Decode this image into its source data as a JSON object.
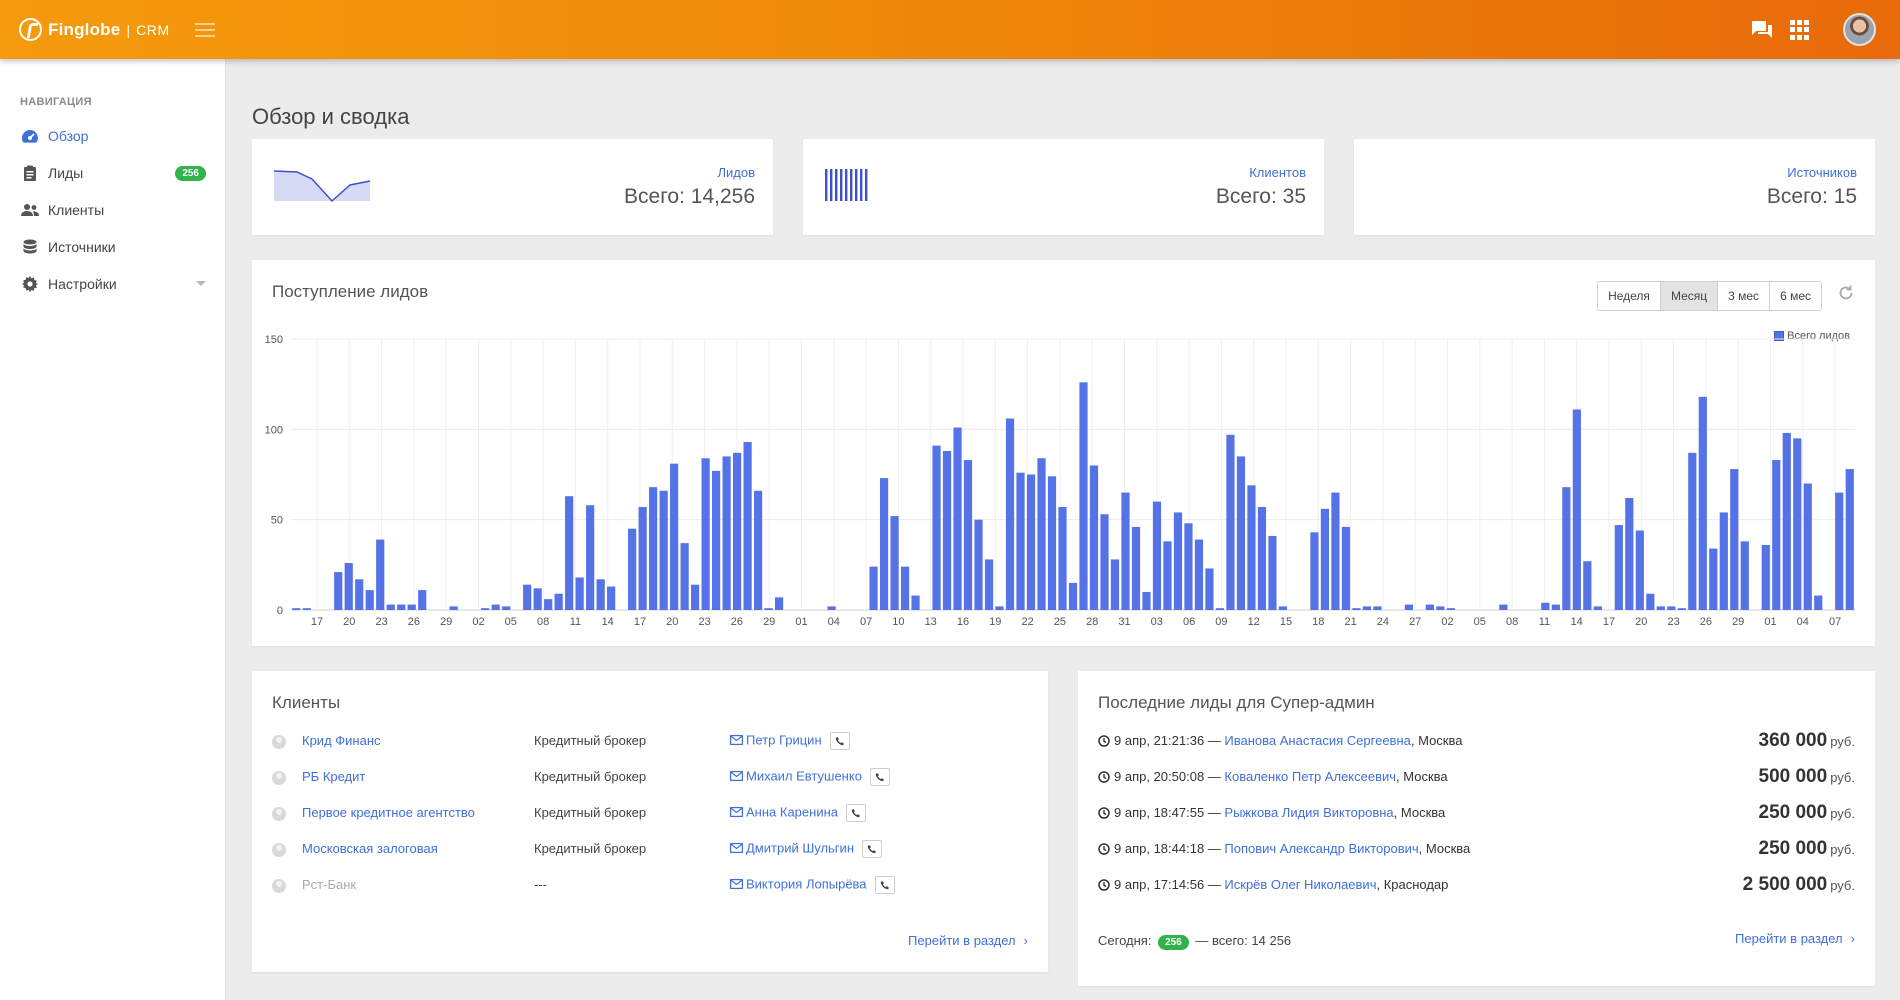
{
  "header": {
    "brand_name": "Finglobe",
    "brand_separator": "|",
    "brand_suffix": "CRM"
  },
  "sidebar": {
    "title": "НАВИГАЦИЯ",
    "items": [
      {
        "label": "Обзор",
        "icon": "dashboard-icon",
        "active": true
      },
      {
        "label": "Лиды",
        "icon": "clipboard-icon",
        "badge": "256"
      },
      {
        "label": "Клиенты",
        "icon": "users-icon"
      },
      {
        "label": "Источники",
        "icon": "database-icon"
      },
      {
        "label": "Настройки",
        "icon": "gear-icon"
      }
    ]
  },
  "page": {
    "title": "Обзор и сводка"
  },
  "stats": [
    {
      "label": "Лидов",
      "value": "Всего: 14,256"
    },
    {
      "label": "Клиентов",
      "value": "Всего: 35"
    },
    {
      "label": "Источников",
      "value": "Всего: 15"
    }
  ],
  "leads_chart": {
    "title": "Поступление лидов",
    "periods": [
      "Неделя",
      "Месяц",
      "3 мес",
      "6 мес"
    ],
    "active_period": "Месяц",
    "legend": "Всего лидов"
  },
  "chart_data": {
    "type": "bar",
    "title": "Поступление лидов",
    "ylim": [
      0,
      150
    ],
    "yticks": [
      "0",
      "50",
      "100",
      "150"
    ],
    "grid": true,
    "legend_position": "top-right",
    "series_name": "Всего лидов",
    "color": "#5573e6",
    "xticks": [
      "17",
      "20",
      "23",
      "26",
      "29",
      "02",
      "05",
      "08",
      "11",
      "14",
      "17",
      "20",
      "23",
      "26",
      "29",
      "01",
      "04",
      "07",
      "10",
      "13",
      "16",
      "19",
      "22",
      "25",
      "28",
      "31",
      "03",
      "06",
      "09",
      "12",
      "15",
      "18",
      "21",
      "24",
      "27",
      "02",
      "05",
      "08",
      "11",
      "14",
      "17",
      "20",
      "23",
      "26",
      "29",
      "01",
      "04",
      "07"
    ],
    "values": [
      1,
      1,
      0,
      0,
      21,
      26,
      17,
      11,
      39,
      3,
      3,
      3,
      11,
      0,
      0,
      2,
      0,
      0,
      1,
      3,
      2,
      0,
      14,
      12,
      6,
      9,
      63,
      18,
      58,
      17,
      13,
      0,
      45,
      57,
      68,
      66,
      81,
      37,
      14,
      84,
      77,
      85,
      87,
      93,
      66,
      1,
      7,
      0,
      0,
      0,
      0,
      2,
      0,
      0,
      0,
      24,
      73,
      52,
      24,
      8,
      0,
      91,
      88,
      101,
      83,
      50,
      28,
      2,
      106,
      76,
      75,
      84,
      74,
      57,
      15,
      126,
      80,
      53,
      28,
      65,
      46,
      10,
      60,
      38,
      54,
      48,
      39,
      23,
      1,
      97,
      85,
      69,
      57,
      41,
      2,
      0,
      0,
      43,
      56,
      65,
      46,
      1,
      2,
      2,
      0,
      0,
      3,
      0,
      3,
      2,
      1,
      0,
      0,
      0,
      0,
      3,
      0,
      0,
      0,
      4,
      3,
      68,
      111,
      27,
      2,
      0,
      47,
      62,
      44,
      9,
      2,
      2,
      1,
      87,
      118,
      34,
      54,
      78,
      38,
      0,
      36,
      83,
      98,
      95,
      70,
      8,
      0,
      65,
      78
    ]
  },
  "clients": {
    "title": "Клиенты",
    "rows": [
      {
        "name": "Крид Финанс",
        "type": "Кредитный брокер",
        "contact": "Петр Грицин"
      },
      {
        "name": "РБ Кредит",
        "type": "Кредитный брокер",
        "contact": "Михаил Евтушенко"
      },
      {
        "name": "Первое кредитное агентство",
        "type": "Кредитный брокер",
        "contact": "Анна Каренина"
      },
      {
        "name": "Московская залоговая",
        "type": "Кредитный брокер",
        "contact": "Дмитрий Шульгин"
      },
      {
        "name": "Рст-Банк",
        "type": "---",
        "contact": "Виктория Лопырёва",
        "inactive": true
      }
    ],
    "goto": "Перейти в раздел",
    "goto_chevron": "›"
  },
  "leads": {
    "title": "Последние лиды для Супер-админ",
    "rows": [
      {
        "time": "9 апр, 21:21:36 —",
        "name": "Иванова Анастасия Сергеевна",
        "city": ", Москва",
        "amount": "360 000",
        "currency": "руб."
      },
      {
        "time": "9 апр, 20:50:08 —",
        "name": "Коваленко Петр Алексеевич",
        "city": ", Москва",
        "amount": "500 000",
        "currency": "руб."
      },
      {
        "time": "9 апр, 18:47:55 —",
        "name": "Рыжкова Лидия Викторовна",
        "city": ", Москва",
        "amount": "250 000",
        "currency": "руб."
      },
      {
        "time": "9 апр, 18:44:18 —",
        "name": "Попович Александр Викторович",
        "city": ", Москва",
        "amount": "250 000",
        "currency": "руб."
      },
      {
        "time": "9 апр, 17:14:56 —",
        "name": "Искрёв Олег Николаевич",
        "city": ", Краснодар",
        "amount": "2 500 000",
        "currency": "руб."
      }
    ],
    "today_label": "Сегодня:",
    "today_count": "256",
    "total_text": "— всего: 14 256",
    "goto": "Перейти в раздел",
    "goto_chevron": "›"
  }
}
